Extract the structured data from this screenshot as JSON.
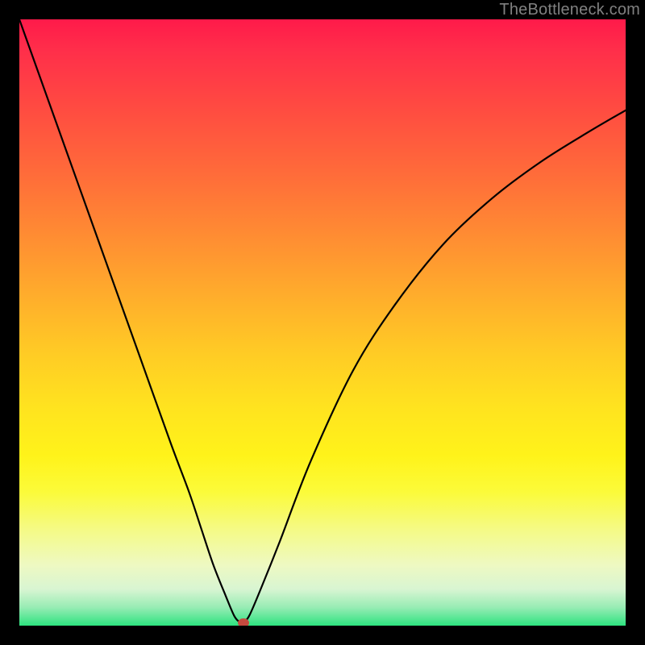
{
  "attribution_text": "TheBottleneck.com",
  "colors": {
    "page_bg": "#000000",
    "attribution": "#808080",
    "curve": "#000000",
    "marker": "#c54a3f",
    "gradient_top": "#ff1a4a",
    "gradient_bottom": "#2de37f"
  },
  "chart_data": {
    "type": "line",
    "title": "",
    "xlabel": "",
    "ylabel": "",
    "xlim": [
      0,
      100
    ],
    "ylim": [
      0,
      100
    ],
    "grid": false,
    "legend": false,
    "annotations": [],
    "series": [
      {
        "name": "curve",
        "x": [
          0,
          5,
          10,
          15,
          20,
          25,
          28,
          30,
          32,
          34,
          35.5,
          36.5,
          37,
          38,
          40,
          43,
          48,
          55,
          62,
          70,
          78,
          86,
          94,
          100
        ],
        "y": [
          100,
          86,
          72,
          58,
          44,
          30,
          22,
          16,
          10,
          5,
          1.5,
          0.5,
          0.5,
          1.8,
          6.5,
          14,
          27,
          42,
          53,
          63,
          70.5,
          76.5,
          81.5,
          85
        ]
      }
    ],
    "marker": {
      "x": 37,
      "y": 0.5
    }
  }
}
